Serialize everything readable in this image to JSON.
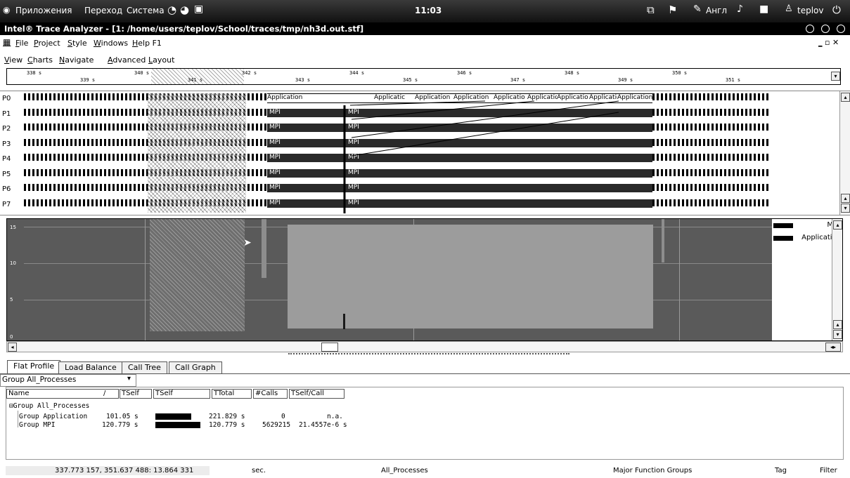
{
  "panel": {
    "menus": [
      "Приложения",
      "Переход",
      "Система"
    ],
    "clock": "11:03",
    "keyboard": "Англ",
    "user": "teplov"
  },
  "window": {
    "title": "Intel® Trace Analyzer - [1: /home/users/teplov/School/traces/tmp/nh3d.out.stf]"
  },
  "menubar1": [
    "File",
    "Project",
    "Style",
    "Windows",
    "Help F1"
  ],
  "menubar2": [
    "View",
    "Charts",
    "Navigate",
    "Advanced",
    "Layout"
  ],
  "ruler": {
    "upper": [
      "338 s",
      "340 s",
      "342 s",
      "344 s",
      "346 s",
      "348 s",
      "350 s"
    ],
    "lower": [
      "339 s",
      "341 s",
      "343 s",
      "345 s",
      "347 s",
      "349 s",
      "351 s"
    ]
  },
  "timeline": {
    "processes": [
      "P0",
      "P1",
      "P2",
      "P3",
      "P4",
      "P5",
      "P6",
      "P7"
    ],
    "app_label": "Application",
    "mpi_label": "MPI",
    "p0_labels": [
      "Application",
      "Applicatic",
      "Application",
      "Application",
      "Applicatio",
      "Applicatic",
      "Applicatio",
      "Applicatio",
      "Application"
    ]
  },
  "activity": {
    "y_ticks": [
      "15",
      "10",
      "5",
      "0"
    ],
    "legend": [
      {
        "label": "MPI",
        "color": "#000000"
      },
      {
        "label": "Application",
        "color": "#000000"
      }
    ]
  },
  "tabs": [
    "Flat Profile",
    "Load Balance",
    "Call Tree",
    "Call Graph"
  ],
  "group_select": "Group All_Processes",
  "table": {
    "headers": [
      "Name",
      "TSelf",
      "TSelf",
      "TTotal",
      "#Calls",
      "TSelf/Call"
    ],
    "root": "Group All_Processes",
    "rows": [
      {
        "name": "Group Application",
        "tself": "101.05 s",
        "ttotal": "221.829 s",
        "calls": "0",
        "tpc": "n.a.",
        "fill": 0.68
      },
      {
        "name": "Group MPI",
        "tself": "120.779 s",
        "ttotal": "120.779 s",
        "calls": "5629215",
        "tpc": "21.4557e-6 s",
        "fill": 0.85
      }
    ]
  },
  "status": {
    "range": "337.773 157, 351.637 488: 13.864 331",
    "unit": "sec.",
    "group": "All_Processes",
    "mode": "Major Function Groups",
    "tag": "Tag",
    "filter": "Filter"
  }
}
